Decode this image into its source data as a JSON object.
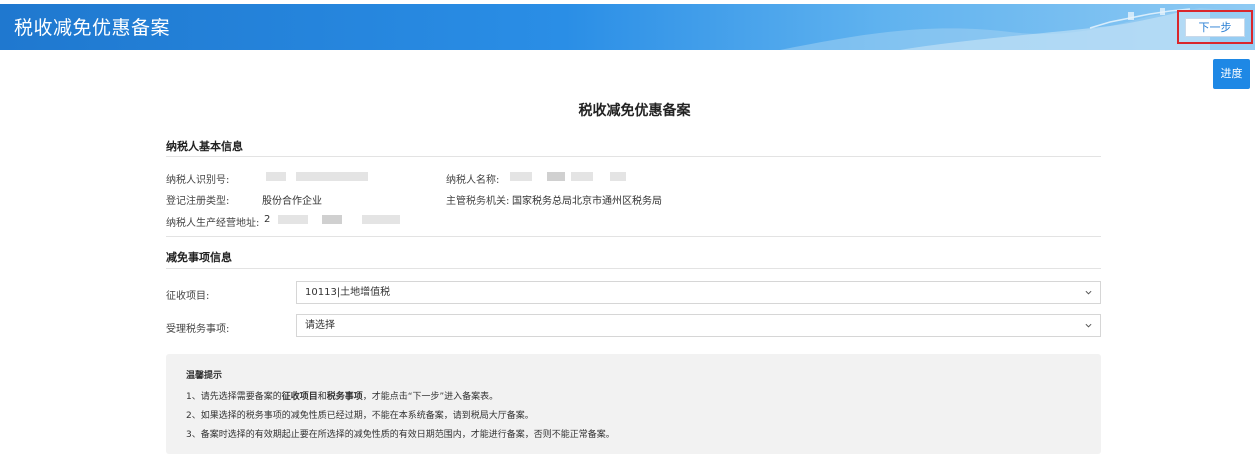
{
  "header": {
    "title": "税收减免优惠备案",
    "next_label": "下一步"
  },
  "progress_label": "进度",
  "page_title": "税收减免优惠备案",
  "basic_info": {
    "section_title": "纳税人基本信息",
    "taxpayer_id_label": "纳税人识别号:",
    "taxpayer_name_label": "纳税人名称:",
    "reg_type_label": "登记注册类型:",
    "reg_type_value": "股份合作企业",
    "authority_label": "主管税务机关:",
    "authority_value": "国家税务总局北京市通州区税务局",
    "address_label": "纳税人生产经营地址:",
    "address_value": "2"
  },
  "exemption_info": {
    "section_title": "减免事项信息",
    "levy_item_label": "征收项目:",
    "levy_item_value": "10113|土地增值税",
    "tax_matter_label": "受理税务事项:",
    "tax_matter_value": "请选择"
  },
  "notice": {
    "title": "温馨提示",
    "line1_pre": "1、请先选择需要备案的",
    "line1_b1": "征收项目",
    "line1_mid": "和",
    "line1_b2": "税务事项",
    "line1_post": "，才能点击“下一步”进入备案表。",
    "line2": "2、如果选择的税务事项的减免性质已经过期，不能在本系统备案，请到税局大厅备案。",
    "line3": "3、备案时选择的有效期起止要在所选择的减免性质的有效日期范围内，才能进行备案，否则不能正常备案。"
  },
  "colors": {
    "header_blue": "#1f78cf",
    "accent_button": "#1e88e5",
    "highlight_red": "#d9262c"
  }
}
